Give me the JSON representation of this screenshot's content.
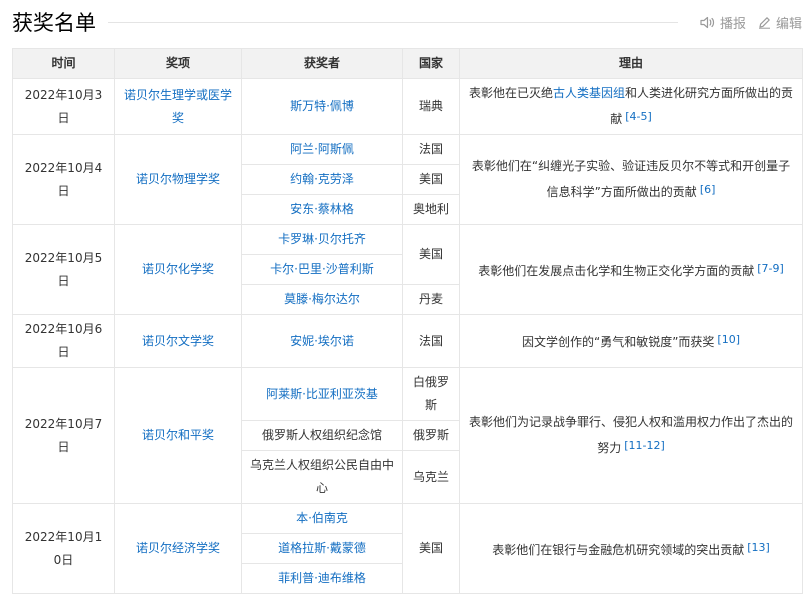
{
  "title": "获奖名单",
  "actions": {
    "play": "播报",
    "edit": "编辑"
  },
  "columns": [
    "时间",
    "奖项",
    "获奖者",
    "国家",
    "理由"
  ],
  "rows": {
    "medicine": {
      "date": "2022年10月3日",
      "prize": "诺贝尔生理学或医学奖",
      "w1": "斯万特·佩博",
      "c1": "瑞典",
      "reason_a": "表彰他在已灭绝",
      "reason_link": "古人类基因组",
      "reason_b": "和人类进化研究方面所做出的贡献",
      "ref": "[4-5]"
    },
    "physics": {
      "date": "2022年10月4日",
      "prize": "诺贝尔物理学奖",
      "w1": "阿兰·阿斯佩",
      "c1": "法国",
      "w2": "约翰·克劳泽",
      "c2": "美国",
      "w3": "安东·蔡林格",
      "c3": "奥地利",
      "reason": "表彰他们在“纠缠光子实验、验证违反贝尔不等式和开创量子信息科学”方面所做出的贡献",
      "ref": "[6]"
    },
    "chemistry": {
      "date": "2022年10月5日",
      "prize": "诺贝尔化学奖",
      "w1": "卡罗琳·贝尔托齐",
      "w2": "卡尔·巴里·沙普利斯",
      "c12": "美国",
      "w3": "莫滕·梅尔达尔",
      "c3": "丹麦",
      "reason": "表彰他们在发展点击化学和生物正交化学方面的贡献",
      "ref": "[7-9]"
    },
    "literature": {
      "date": "2022年10月6日",
      "prize": "诺贝尔文学奖",
      "w1": "安妮·埃尔诺",
      "c1": "法国",
      "reason": "因文学创作的“勇气和敏锐度”而获奖",
      "ref": "[10]"
    },
    "peace": {
      "date": "2022年10月7日",
      "prize": "诺贝尔和平奖",
      "w1": "阿莱斯·比亚利亚茨基",
      "c1": "白俄罗斯",
      "w2": "俄罗斯人权组织纪念馆",
      "c2": "俄罗斯",
      "w3": "乌克兰人权组织公民自由中心",
      "c3": "乌克兰",
      "reason": "表彰他们为记录战争罪行、侵犯人权和滥用权力作出了杰出的努力",
      "ref": "[11-12]"
    },
    "economics": {
      "date": "2022年10月10日",
      "prize": "诺贝尔经济学奖",
      "w1": "本·伯南克",
      "w2": "道格拉斯·戴蒙德",
      "w3": "菲利普·迪布维格",
      "c": "美国",
      "reason": "表彰他们在银行与金融危机研究领域的突出贡献",
      "ref": "[13]"
    }
  }
}
